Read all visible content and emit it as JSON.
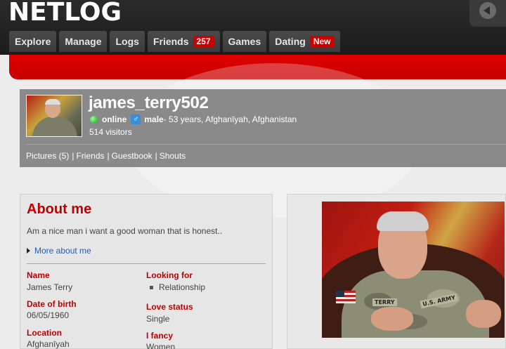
{
  "header": {
    "logo": "NETLOG",
    "nav": [
      {
        "label": "Explore",
        "badge": ""
      },
      {
        "label": "Manage",
        "badge": ""
      },
      {
        "label": "Logs",
        "badge": ""
      },
      {
        "label": "Friends",
        "badge": "257"
      },
      {
        "label": "Games",
        "badge": ""
      },
      {
        "label": "Dating",
        "badge": "New"
      }
    ]
  },
  "profile": {
    "username": "james_terry502",
    "online_label": "online",
    "gender": "male",
    "details": " - 53 years, Afghanīyah, Afghanistan",
    "visitors": "514 visitors",
    "links": [
      "Pictures (5)",
      "Friends",
      "Guestbook",
      "Shouts"
    ],
    "link_separator": "|"
  },
  "about": {
    "title": "About me",
    "text": "Am a nice man i want a good woman that is honest..",
    "more_link": "More about me",
    "fields": {
      "name_label": "Name",
      "name_value": "James Terry",
      "dob_label": "Date of birth",
      "dob_value": "06/05/1960",
      "location_label": "Location",
      "location_value": "Afghanīyah",
      "looking_label": "Looking for",
      "looking_value": "Relationship",
      "love_label": "Love status",
      "love_value": "Single",
      "fancy_label": "I fancy",
      "fancy_value": "Women"
    }
  },
  "photo": {
    "nametape": "TERRY",
    "branch": "U.S. ARMY"
  },
  "colors": {
    "brand_red": "#cc0000",
    "link_blue": "#2060b8",
    "online_green": "#1a9e1a"
  }
}
